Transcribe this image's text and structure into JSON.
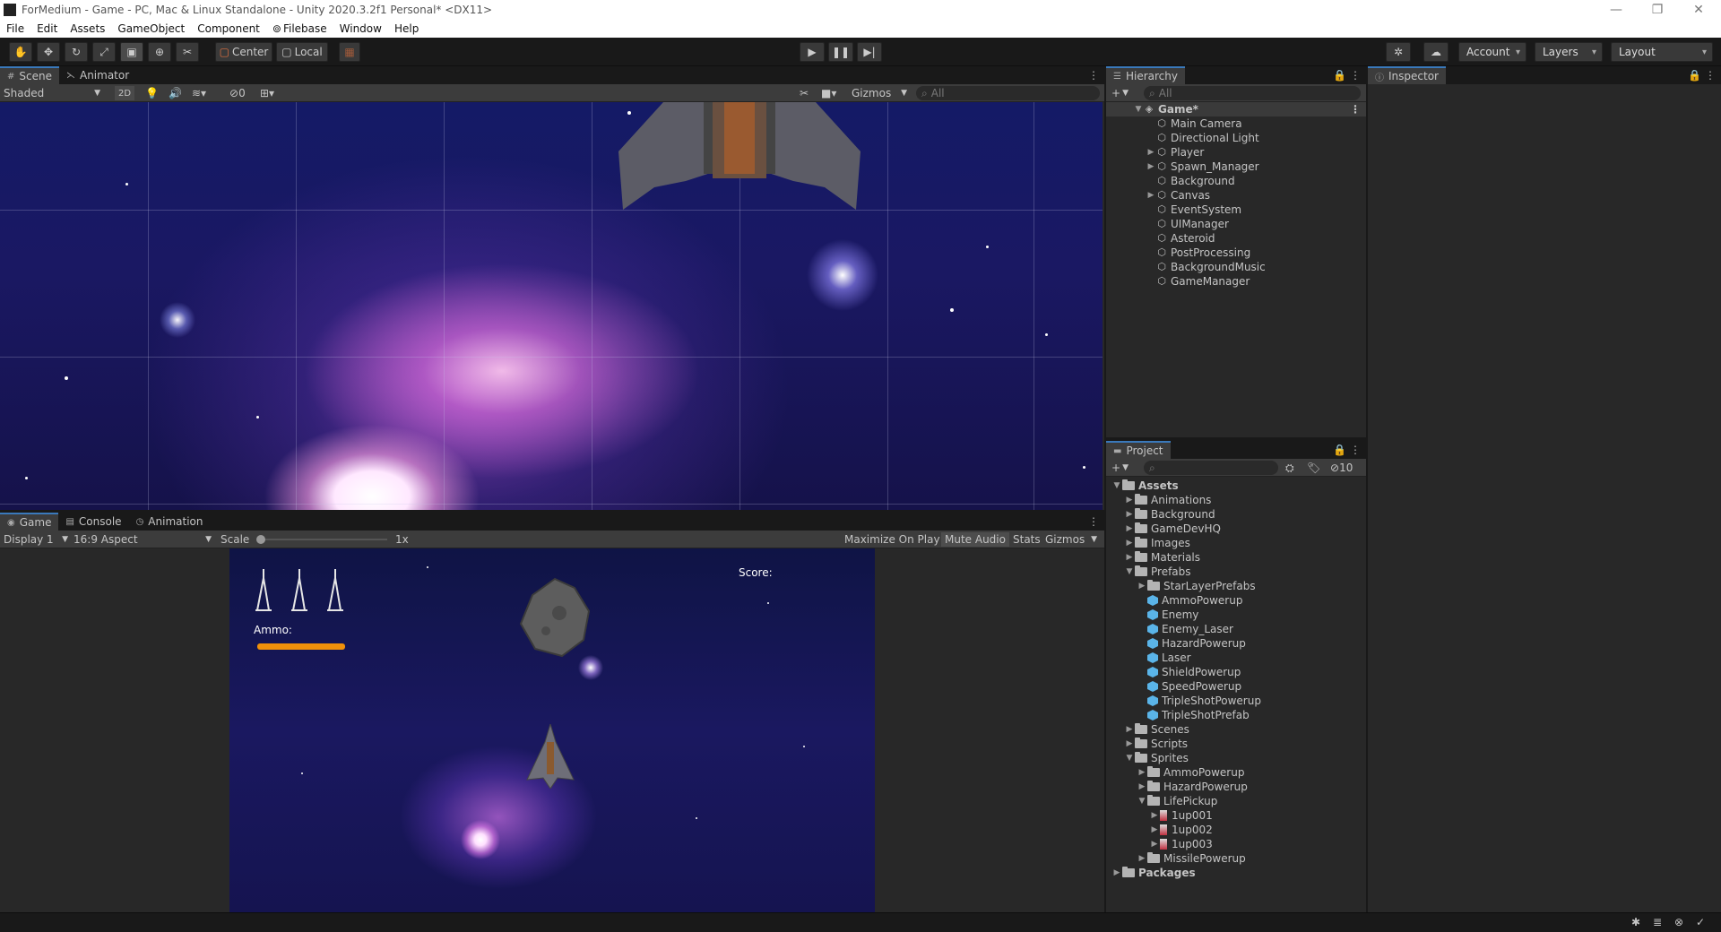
{
  "window": {
    "title": "ForMedium - Game - PC, Mac & Linux Standalone - Unity 2020.3.2f1 Personal* <DX11>",
    "minimize": "—",
    "maximize": "❐",
    "close": "✕"
  },
  "menu": [
    "File",
    "Edit",
    "Assets",
    "GameObject",
    "Component",
    "Filebase",
    "Window",
    "Help"
  ],
  "toolbar": {
    "pivot": "Center",
    "space": "Local",
    "account": "Account",
    "layers": "Layers",
    "layout": "Layout"
  },
  "scene_panel": {
    "tabs": [
      "Scene",
      "Animator"
    ],
    "shading": "Shaded",
    "mode_2d": "2D",
    "hidden_count": "0",
    "gizmos": "Gizmos",
    "search_placeholder": "All"
  },
  "game_panel": {
    "tabs": [
      "Game",
      "Console",
      "Animation"
    ],
    "display": "Display 1",
    "aspect": "16:9 Aspect",
    "scale_label": "Scale",
    "scale_value": "1x",
    "maximize": "Maximize On Play",
    "mute": "Mute Audio",
    "stats": "Stats",
    "gizmos": "Gizmos",
    "hud": {
      "score_label": "Score:",
      "ammo_label": "Ammo:",
      "ammo_fraction": 1.0
    }
  },
  "hierarchy": {
    "tab": "Hierarchy",
    "search_placeholder": "All",
    "scene_name": "Game*",
    "items": [
      {
        "name": "Main Camera",
        "expandable": false
      },
      {
        "name": "Directional Light",
        "expandable": false
      },
      {
        "name": "Player",
        "expandable": true
      },
      {
        "name": "Spawn_Manager",
        "expandable": true
      },
      {
        "name": "Background",
        "expandable": false
      },
      {
        "name": "Canvas",
        "expandable": true
      },
      {
        "name": "EventSystem",
        "expandable": false
      },
      {
        "name": "UIManager",
        "expandable": false
      },
      {
        "name": "Asteroid",
        "expandable": false
      },
      {
        "name": "PostProcessing",
        "expandable": false
      },
      {
        "name": "BackgroundMusic",
        "expandable": false
      },
      {
        "name": "GameManager",
        "expandable": false
      }
    ]
  },
  "inspector": {
    "tab": "Inspector"
  },
  "project": {
    "tab": "Project",
    "hidden_count": "10",
    "tree": [
      {
        "label": "Assets",
        "depth": 0,
        "kind": "folder",
        "arrow": "▼",
        "bold": true
      },
      {
        "label": "Animations",
        "depth": 1,
        "kind": "folder",
        "arrow": "▶"
      },
      {
        "label": "Background",
        "depth": 1,
        "kind": "folder",
        "arrow": "▶"
      },
      {
        "label": "GameDevHQ",
        "depth": 1,
        "kind": "folder",
        "arrow": "▶"
      },
      {
        "label": "Images",
        "depth": 1,
        "kind": "folder",
        "arrow": "▶"
      },
      {
        "label": "Materials",
        "depth": 1,
        "kind": "folder",
        "arrow": "▶"
      },
      {
        "label": "Prefabs",
        "depth": 1,
        "kind": "folder",
        "arrow": "▼"
      },
      {
        "label": "StarLayerPrefabs",
        "depth": 2,
        "kind": "folder",
        "arrow": "▶"
      },
      {
        "label": "AmmoPowerup",
        "depth": 2,
        "kind": "prefab",
        "arrow": ""
      },
      {
        "label": "Enemy",
        "depth": 2,
        "kind": "prefab",
        "arrow": ""
      },
      {
        "label": "Enemy_Laser",
        "depth": 2,
        "kind": "prefab",
        "arrow": ""
      },
      {
        "label": "HazardPowerup",
        "depth": 2,
        "kind": "prefab",
        "arrow": ""
      },
      {
        "label": "Laser",
        "depth": 2,
        "kind": "prefab",
        "arrow": ""
      },
      {
        "label": "ShieldPowerup",
        "depth": 2,
        "kind": "prefab",
        "arrow": ""
      },
      {
        "label": "SpeedPowerup",
        "depth": 2,
        "kind": "prefab",
        "arrow": ""
      },
      {
        "label": "TripleShotPowerup",
        "depth": 2,
        "kind": "prefab",
        "arrow": ""
      },
      {
        "label": "TripleShotPrefab",
        "depth": 2,
        "kind": "prefab",
        "arrow": ""
      },
      {
        "label": "Scenes",
        "depth": 1,
        "kind": "folder",
        "arrow": "▶"
      },
      {
        "label": "Scripts",
        "depth": 1,
        "kind": "folder",
        "arrow": "▶"
      },
      {
        "label": "Sprites",
        "depth": 1,
        "kind": "folder",
        "arrow": "▼"
      },
      {
        "label": "AmmoPowerup",
        "depth": 2,
        "kind": "folder",
        "arrow": "▶"
      },
      {
        "label": "HazardPowerup",
        "depth": 2,
        "kind": "folder",
        "arrow": "▶"
      },
      {
        "label": "LifePickup",
        "depth": 2,
        "kind": "folder",
        "arrow": "▼"
      },
      {
        "label": "1up001",
        "depth": 3,
        "kind": "sprite",
        "arrow": "▶"
      },
      {
        "label": "1up002",
        "depth": 3,
        "kind": "sprite",
        "arrow": "▶"
      },
      {
        "label": "1up003",
        "depth": 3,
        "kind": "sprite",
        "arrow": "▶"
      },
      {
        "label": "MissilePowerup",
        "depth": 2,
        "kind": "folder",
        "arrow": "▶"
      },
      {
        "label": "Packages",
        "depth": 0,
        "kind": "folder",
        "arrow": "▶",
        "bold": true
      }
    ]
  },
  "colors": {
    "accent": "#3a79bb",
    "ammo_bar": "#f0900a",
    "prefab": "#5ab4e8"
  }
}
